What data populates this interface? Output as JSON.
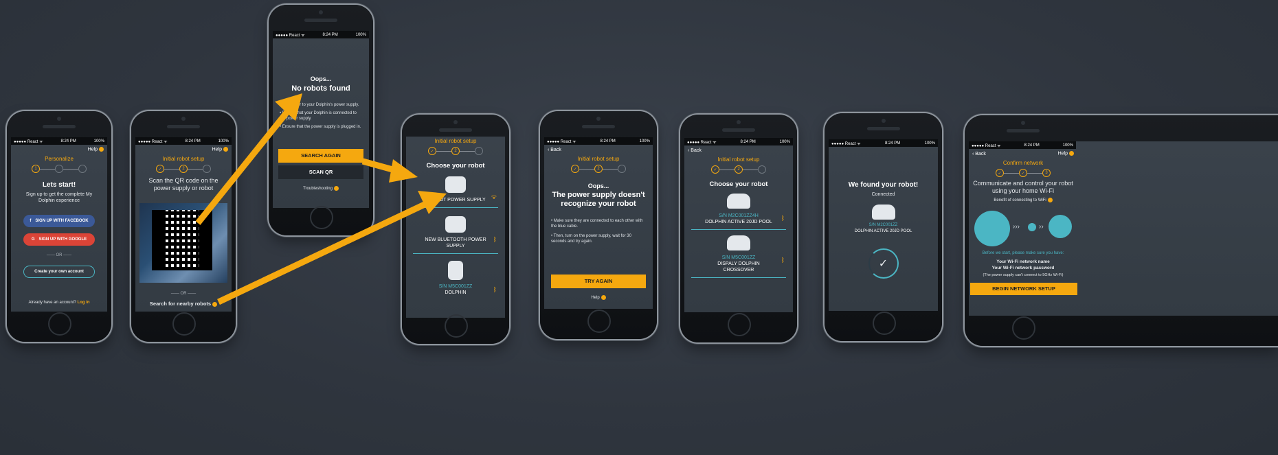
{
  "status": {
    "carrier": "●●●●● React ᯤ",
    "time": "8:24 PM",
    "battery": "100%"
  },
  "screen1": {
    "help": "Help",
    "step_title": "Personalize",
    "title": "Lets start!",
    "subtitle": "Sign up to get the complete My Dolphin experience",
    "facebook": "SIGN UP WITH FACEBOOK",
    "google": "SIGN UP WITH GOOGLE",
    "or": "—— OR ——",
    "create": "Create your own account",
    "have_account": "Already have an account?",
    "login": "Log in"
  },
  "screen2": {
    "help": "Help",
    "step_title": "Initial robot setup",
    "scan_text": "Scan the QR code on the power supply or robot",
    "or": "—— OR ——",
    "search": "Search for nearby robots"
  },
  "screen3": {
    "oops": "Oops...",
    "title": "No robots found",
    "b1": "• Get closer to your Dolphin's power supply.",
    "b2": "• Ensure that your Dolphin is connected to the power supply.",
    "b3": "• Ensure that the power supply is plugged in.",
    "search_again": "SEARCH AGAIN",
    "scan_qr": "SCAN QR",
    "trouble": "Troubleshooting"
  },
  "screen4": {
    "step_title": "Initial robot setup",
    "title": "Choose your robot",
    "r1": "NEW IOT POWER SUPPLY",
    "r2": "NEW BLUETOOTH POWER SUPPLY",
    "r3_sn": "S/N M5C001ZZ",
    "r3": "DOLPHIN"
  },
  "screen5": {
    "back": "Back",
    "step_title": "Initial robot setup",
    "oops": "Oops...",
    "title": "The power supply doesn't recognize your robot",
    "b1": "• Make sure they are connected to each other with the blue cable.",
    "b2": "• Then, turn on the power supply, wait for 30 seconds and try again.",
    "try_again": "TRY AGAIN",
    "help": "Help"
  },
  "screen6": {
    "back": "Back",
    "step_title": "Initial robot setup",
    "title": "Choose your robot",
    "r1_sn": "S/N M2C001ZZ4H",
    "r1": "DOLPHIN ACTIVE 20JD POOL",
    "r2_sn": "S/N M5C001ZZ",
    "r2": "DISPALY DOLPHIN CROSSOVER"
  },
  "screen7": {
    "title": "We found your robot!",
    "sub": "Connected",
    "sn": "S/N M2C001ZZ",
    "robot": "DOLPHIN ACTIVE 20JD POOL"
  },
  "screen8": {
    "back": "Back",
    "help": "Help",
    "step_title": "Confirm network",
    "title": "Communicate and control your robot using your home Wi-Fi",
    "benefit": "Benefit of connecting to WiFi",
    "before": "Before we start, please make sure you have:",
    "n1": "Your Wi-Fi network name",
    "n2": "Your Wi-Fi network password",
    "note": "(The power supply can't connect to 5GHz Wi-Fi)",
    "begin": "BEGIN NETWORK SETUP"
  },
  "colors": {
    "accent": "#f5a80f",
    "facebook": "#3b5998",
    "google": "#db4437",
    "teal": "#4bb6c4"
  }
}
